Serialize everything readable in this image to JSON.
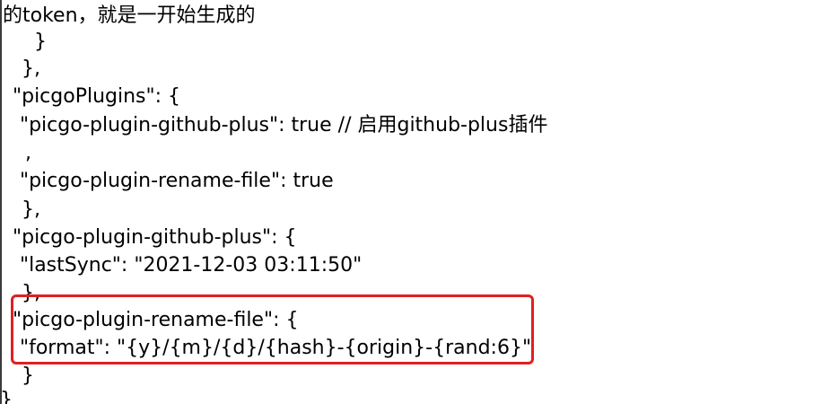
{
  "config_view": {
    "lines": [
      "的token，就是一开始生成的",
      "    }",
      "  },",
      "  \"picgoPlugins\": {",
      "    \"picgo-plugin-github-plus\": true // 启用github-plus插件",
      "    ,",
      "    \"picgo-plugin-rename-file\": true",
      "  },",
      "  \"picgo-plugin-github-plus\": {",
      "    \"lastSync\": \"2021-12-03 03:11:50\"",
      "  },",
      "  \"picgo-plugin-rename-file\": {",
      "    \"format\": \"{y}/{m}/{d}/{hash}-{origin}-{rand:6}\"",
      "  }",
      "}"
    ],
    "highlight_color": "#e02020"
  }
}
